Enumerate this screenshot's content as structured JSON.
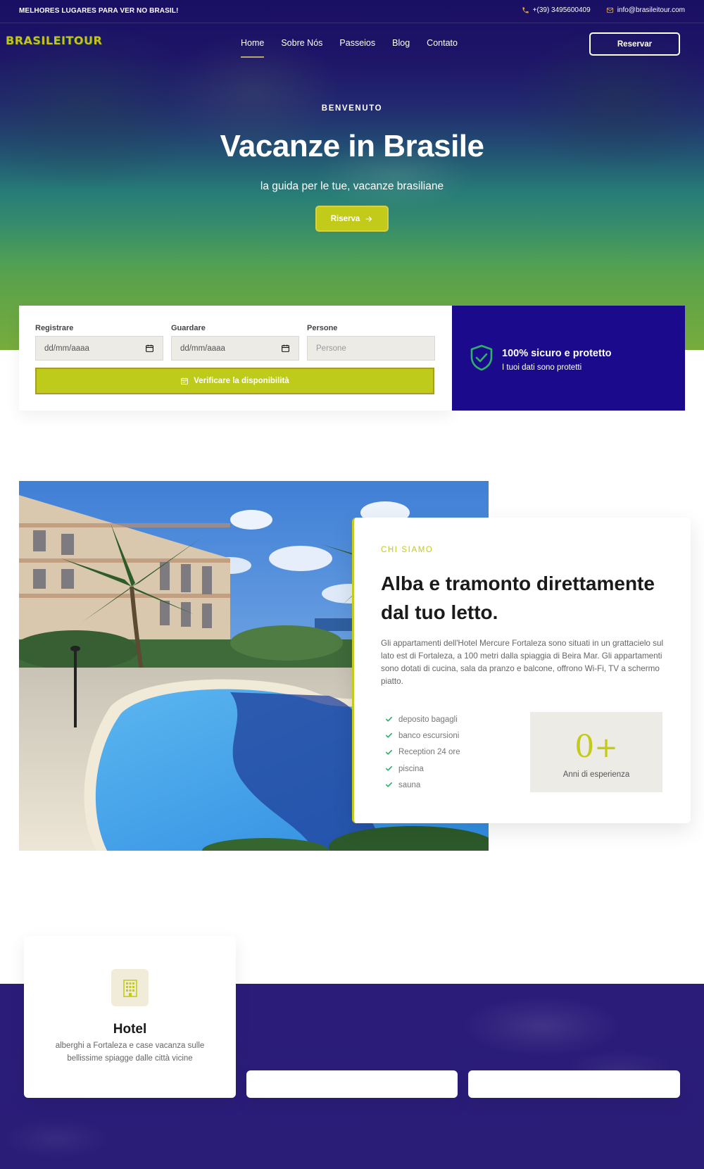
{
  "topbar": {
    "tagline": "MELHORES LUGARES PARA VER NO BRASIL!",
    "phone": "+(39) 3495600409",
    "email": "info@brasileitour.com"
  },
  "header": {
    "logo": "BRASILEITOUR",
    "nav": [
      {
        "label": "Home",
        "active": true
      },
      {
        "label": "Sobre Nós"
      },
      {
        "label": "Passeios"
      },
      {
        "label": "Blog"
      },
      {
        "label": "Contato"
      }
    ],
    "cta": "Reservar"
  },
  "hero": {
    "eyebrow": "BENVENUTO",
    "title": "Vacanze in Brasile",
    "subtitle": "la guida per le tue, vacanze brasiliane",
    "button": "Riserva"
  },
  "booking": {
    "checkin": {
      "label": "Registrare",
      "value": "dd/mm/aaaa"
    },
    "checkout": {
      "label": "Guardare",
      "value": "dd/mm/aaaa"
    },
    "persons": {
      "label": "Persone",
      "placeholder": "Persone"
    },
    "submit": "Verificare la disponibilità"
  },
  "secure": {
    "title": "100% sicuro e protetto",
    "subtitle": "I tuoi dati sono protetti"
  },
  "about": {
    "eyebrow": "CHI SIAMO",
    "title": "Alba e tramonto direttamente dal tuo letto.",
    "body": "Gli appartamenti dell'Hotel Mercure Fortaleza sono situati in un grattacielo sul lato est di Fortaleza, a 100 metri dalla spiaggia di Beira Mar. Gli appartamenti sono dotati di cucina, sala da pranzo e balcone, offrono Wi-Fi, TV a schermo piatto.",
    "features": [
      "deposito bagagli",
      "banco escursioni",
      "Reception 24 ore",
      "piscina",
      "sauna"
    ],
    "experience": {
      "number": "0",
      "suffix": "+",
      "label": "Anni di esperienza"
    }
  },
  "services": [
    {
      "title": "Hotel",
      "description": "alberghi a Fortaleza e case vacanza sulle bellissime spiagge dalle città vicine"
    }
  ],
  "colors": {
    "accent": "#c3cb1a",
    "navy": "#1b0a8c",
    "check": "#2fb06a"
  }
}
